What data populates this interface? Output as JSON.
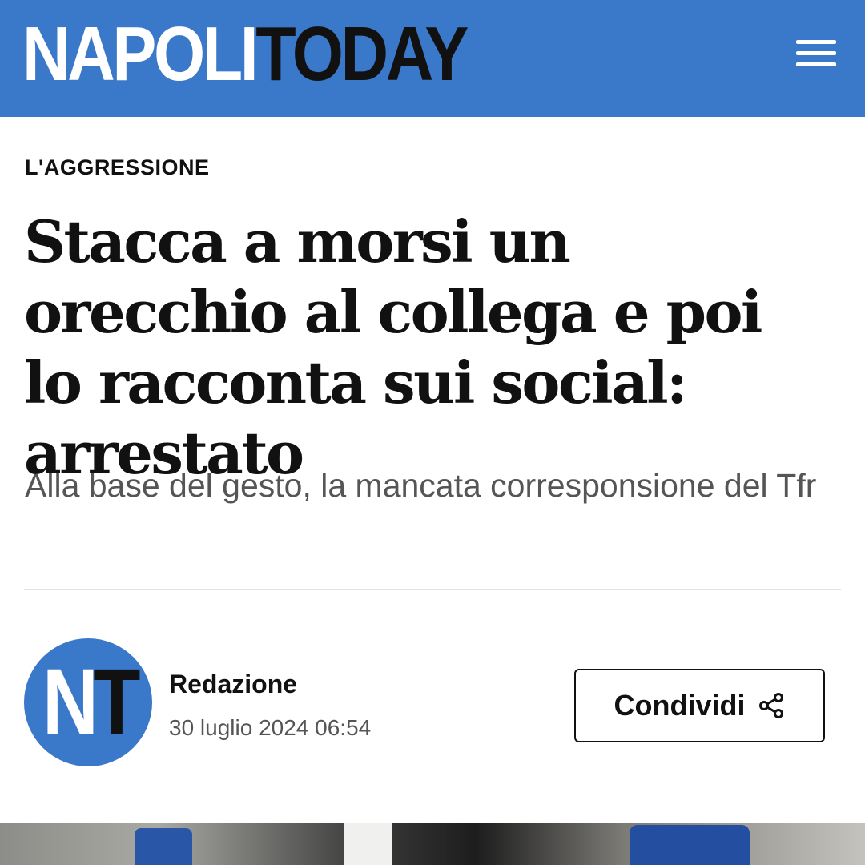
{
  "header": {
    "logo_part1": "NAPOLI",
    "logo_part2": "TODAY",
    "menu_icon": "hamburger-menu-icon",
    "brand_color": "#3a78c9"
  },
  "article": {
    "category": "L'AGGRESSIONE",
    "headline": "Stacca a morsi un orecchio al collega e poi lo racconta sui social: arrestato",
    "subtitle": "Alla base del gesto, la mancata corresponsione del Tfr"
  },
  "byline": {
    "avatar_part1": "N",
    "avatar_part2": "T",
    "author": "Redazione",
    "date": "30 luglio 2024 06:54"
  },
  "share": {
    "label": "Condividi",
    "icon": "share-icon"
  }
}
